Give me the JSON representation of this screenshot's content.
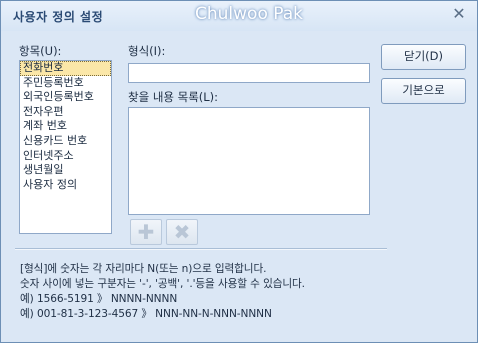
{
  "dialog": {
    "title": "사용자 정의 설정",
    "watermark": "Chulwoo Pak",
    "close_glyph": "✕"
  },
  "items": {
    "label": "항목(U):",
    "list": [
      "전화번호",
      "주민등록번호",
      "외국인등록번호",
      "전자우편",
      "계좌 번호",
      "신용카드 번호",
      "인터넷주소",
      "생년월일",
      "사용자 정의"
    ],
    "selected": "전화번호"
  },
  "format": {
    "label": "형식(I):",
    "value": ""
  },
  "find_list": {
    "label": "찾을 내용 목록(L):",
    "value": ""
  },
  "icons": {
    "add": "add-icon",
    "delete": "delete-icon"
  },
  "buttons": {
    "close_label": "닫기(D)",
    "default_label": "기본으로"
  },
  "info": {
    "line1": "[형식]에 숫자는 각 자리마다 N(또는 n)으로 입력합니다.",
    "line2": "숫자 사이에 넣는 구분자는 '-', '공백', '.'등을 사용할 수 있습니다.",
    "line3": "예) 1566-5191 》 NNNN-NNNN",
    "line4": "예) 001-81-3-123-4567 》 NNN-NN-N-NNN-NNNN"
  }
}
